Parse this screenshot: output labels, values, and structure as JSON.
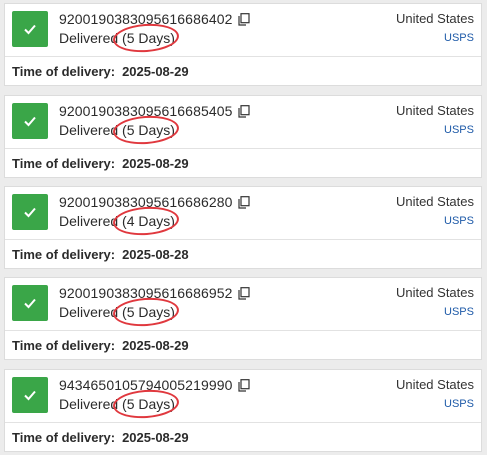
{
  "theme": {
    "status_green": "#3aa648",
    "annotation_red": "#e0383e",
    "carrier_blue": "#1e5aa8"
  },
  "icons": {
    "status": "checkmark-icon",
    "copy": "copy-icon"
  },
  "shipments": [
    {
      "tracking": "9200190383095616686402",
      "status": "Delivered",
      "days": "(5 Days)",
      "country": "United States",
      "carrier": "USPS",
      "delivery_label": "Time of delivery:",
      "delivery_date": "2025-08-29"
    },
    {
      "tracking": "9200190383095616685405",
      "status": "Delivered",
      "days": "(5 Days)",
      "country": "United States",
      "carrier": "USPS",
      "delivery_label": "Time of delivery:",
      "delivery_date": "2025-08-29"
    },
    {
      "tracking": "9200190383095616686280",
      "status": "Delivered",
      "days": "(4 Days)",
      "country": "United States",
      "carrier": "USPS",
      "delivery_label": "Time of delivery:",
      "delivery_date": "2025-08-28"
    },
    {
      "tracking": "9200190383095616686952",
      "status": "Delivered",
      "days": "(5 Days)",
      "country": "United States",
      "carrier": "USPS",
      "delivery_label": "Time of delivery:",
      "delivery_date": "2025-08-29"
    },
    {
      "tracking": "9434650105794005219990",
      "status": "Delivered",
      "days": "(5 Days)",
      "country": "United States",
      "carrier": "USPS",
      "delivery_label": "Time of delivery:",
      "delivery_date": "2025-08-29"
    }
  ]
}
